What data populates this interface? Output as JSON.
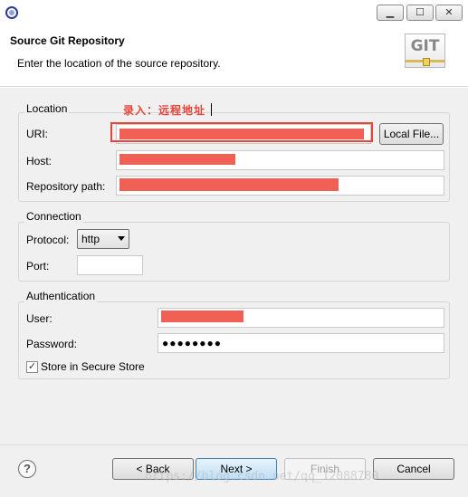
{
  "window": {
    "min_glyph": "▁",
    "max_glyph": "☐",
    "close_glyph": "✕"
  },
  "header": {
    "title": "Source Git Repository",
    "description": "Enter the location of the source repository.",
    "logo_text": "GIT"
  },
  "annotation": {
    "text": "录入：远程地址",
    "color": "#e8443a"
  },
  "location": {
    "legend": "Location",
    "uri_label": "URI:",
    "local_file_button": "Local File...",
    "host_label": "Host:",
    "repo_path_label": "Repository path:"
  },
  "connection": {
    "legend": "Connection",
    "protocol_label": "Protocol:",
    "protocol_value": "http",
    "port_label": "Port:",
    "port_value": ""
  },
  "authentication": {
    "legend": "Authentication",
    "user_label": "User:",
    "password_label": "Password:",
    "password_mask": "●●●●●●●●",
    "store_checked": true,
    "store_label": "Store in Secure Store"
  },
  "footer": {
    "help_glyph": "?",
    "back_button": "< Back",
    "next_button": "Next >",
    "finish_button": "Finish",
    "cancel_button": "Cancel"
  },
  "watermark": "https://blog.csdn.net/qq_12088780",
  "colors": {
    "redaction": "#f06055",
    "dialog_bg": "#f0f0f0"
  }
}
